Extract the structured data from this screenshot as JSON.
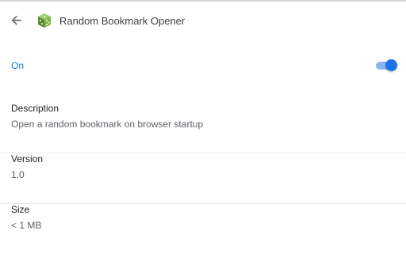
{
  "header": {
    "title": "Random Bookmark Opener",
    "back_icon": "arrow-back-icon",
    "extension_icon": "green-dice-icon"
  },
  "status": {
    "label": "On",
    "toggle_on": true,
    "accent_color": "#1a73e8"
  },
  "details": [
    {
      "heading": "Description",
      "value": "Open a random bookmark on browser startup"
    },
    {
      "heading": "Version",
      "value": "1.0"
    },
    {
      "heading": "Size",
      "value": "< 1 MB"
    }
  ]
}
